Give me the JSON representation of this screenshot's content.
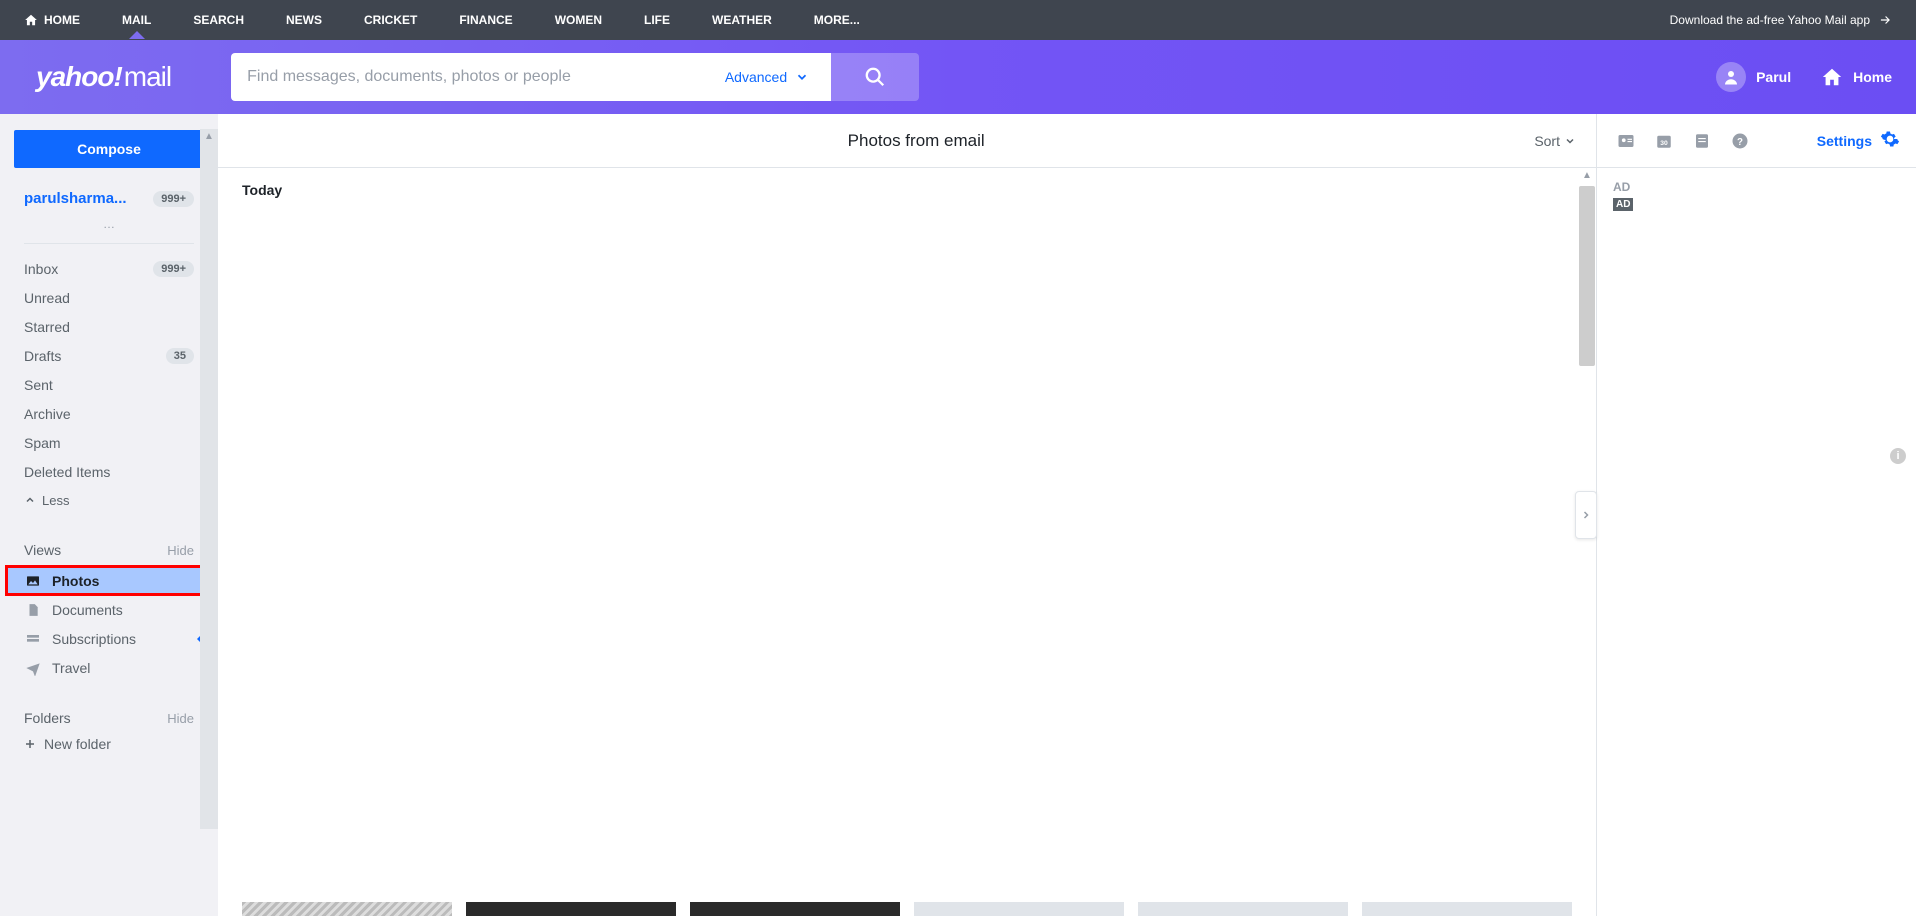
{
  "globalNav": {
    "items": [
      "HOME",
      "MAIL",
      "SEARCH",
      "NEWS",
      "CRICKET",
      "FINANCE",
      "WOMEN",
      "LIFE",
      "WEATHER",
      "MORE..."
    ],
    "download": "Download the ad-free Yahoo Mail app"
  },
  "header": {
    "logo_yahoo": "yahoo!",
    "logo_mail": "mail",
    "search_placeholder": "Find messages, documents, photos or people",
    "advanced": "Advanced",
    "user_name": "Parul",
    "home": "Home"
  },
  "sidebar": {
    "compose": "Compose",
    "account_name": "parulsharma...",
    "account_badge": "999+",
    "folders": [
      {
        "label": "Inbox",
        "badge": "999+"
      },
      {
        "label": "Unread",
        "badge": ""
      },
      {
        "label": "Starred",
        "badge": ""
      },
      {
        "label": "Drafts",
        "badge": "35"
      },
      {
        "label": "Sent",
        "badge": ""
      },
      {
        "label": "Archive",
        "badge": ""
      },
      {
        "label": "Spam",
        "badge": ""
      },
      {
        "label": "Deleted Items",
        "badge": ""
      }
    ],
    "less": "Less",
    "views_title": "Views",
    "views_hide": "Hide",
    "views": [
      {
        "label": "Photos",
        "icon": "photo"
      },
      {
        "label": "Documents",
        "icon": "document"
      },
      {
        "label": "Subscriptions",
        "icon": "subscriptions"
      },
      {
        "label": "Travel",
        "icon": "travel"
      }
    ],
    "new_tag": "New",
    "folders_title": "Folders",
    "folders_hide": "Hide",
    "new_folder": "New folder"
  },
  "content": {
    "title": "Photos from email",
    "sort": "Sort",
    "today": "Today"
  },
  "rail": {
    "settings": "Settings",
    "ad_label": "AD",
    "ad_badge": "AD"
  }
}
